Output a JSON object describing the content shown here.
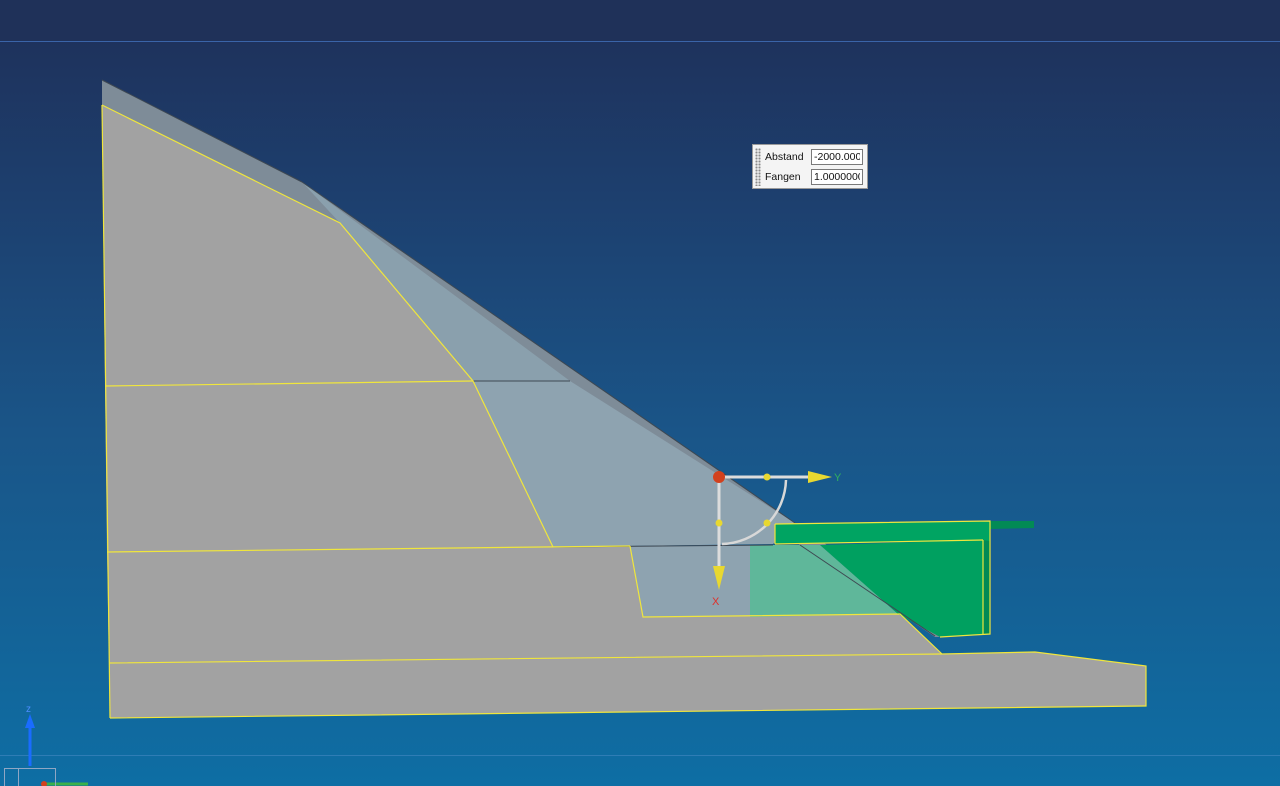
{
  "handle_panel": {
    "distance_label": "Abstand",
    "distance_value": "-2000.000",
    "snap_label": "Fangen",
    "snap_value": "1.0000000"
  },
  "manipulator": {
    "y_axis_label": "Y",
    "x_axis_label": "X"
  },
  "triad": {
    "z_label": "z"
  },
  "colors": {
    "background_top": "#1e2f58",
    "background_bottom": "#0e6ea4",
    "solid_gray": "#a2a2a2",
    "face_light": "#8aa1ae",
    "edge_highlight": "#f0e63c",
    "selected_green": "#00a060",
    "handle_origin": "#d2411e",
    "handle_yellow": "#e8d830"
  }
}
